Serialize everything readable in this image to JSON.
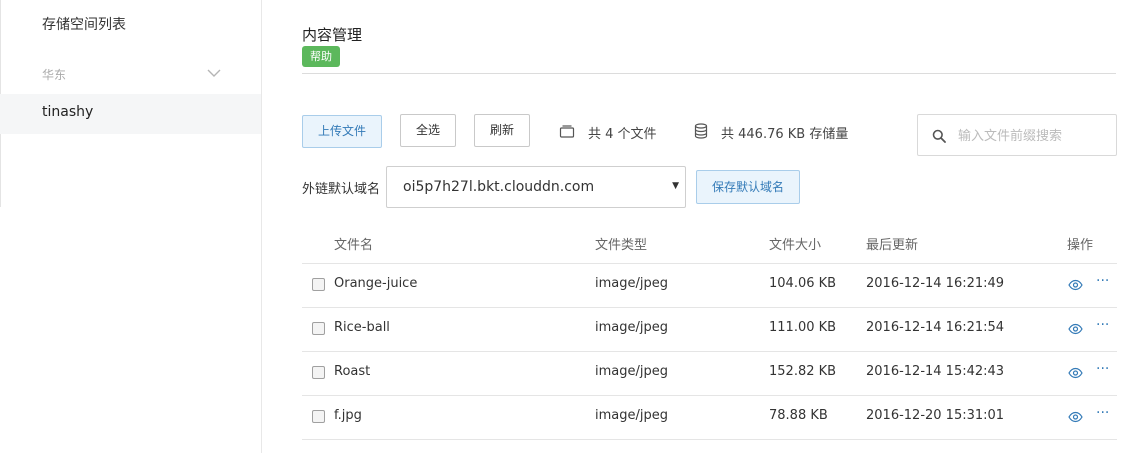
{
  "sidebar": {
    "title": "存储空间列表",
    "region": {
      "label": "华东",
      "icon": "chevron-down-icon"
    },
    "items": [
      {
        "label": "tinashy",
        "selected": true
      }
    ]
  },
  "header": {
    "title": "内容管理",
    "help_label": "帮助",
    "help_color": "#5cb85c"
  },
  "toolbar": {
    "upload_label": "上传文件",
    "select_all_label": "全选",
    "refresh_label": "刷新",
    "file_count_text": "共 4 个文件",
    "storage_text": "共 446.76 KB 存储量",
    "search_placeholder": "输入文件前缀搜索"
  },
  "domain": {
    "label": "外链默认域名",
    "selected": "oi5p7h27l.bkt.clouddn.com",
    "save_label": "保存默认域名"
  },
  "table": {
    "columns": [
      "文件名",
      "文件类型",
      "文件大小",
      "最后更新",
      "操作"
    ],
    "rows": [
      {
        "name": "Orange-juice",
        "type": "image/jpeg",
        "size": "104.06 KB",
        "updated": "2016-12-14 16:21:49"
      },
      {
        "name": "Rice-ball",
        "type": "image/jpeg",
        "size": "111.00 KB",
        "updated": "2016-12-14 16:21:54"
      },
      {
        "name": "Roast",
        "type": "image/jpeg",
        "size": "152.82 KB",
        "updated": "2016-12-14 15:42:43"
      },
      {
        "name": "f.jpg",
        "type": "image/jpeg",
        "size": "78.88 KB",
        "updated": "2016-12-20 15:31:01"
      }
    ],
    "more_label": "···",
    "action_color": "#337ab7"
  }
}
